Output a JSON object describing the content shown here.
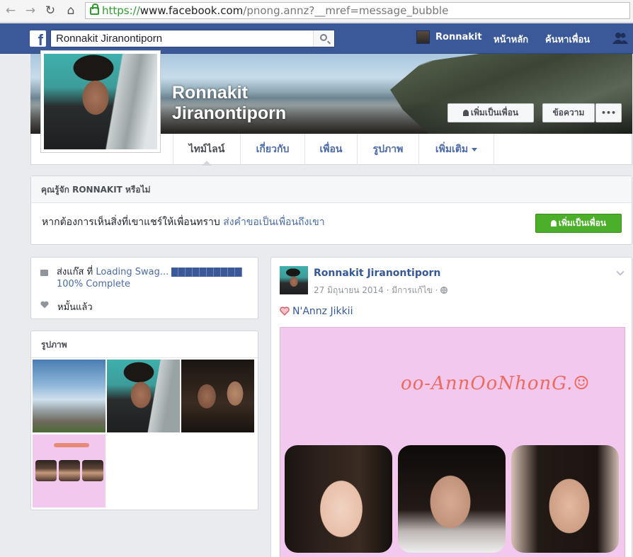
{
  "browser": {
    "url_protocol": "https://",
    "url_host": "www.facebook.com",
    "url_path": "/pnong.annz?__mref=message_bubble"
  },
  "header": {
    "search_value": "Ronnakit Jiranontiporn",
    "user_name": "Ronnakit",
    "home_label": "หน้าหลัก",
    "find_friends_label": "ค้นหาเพื่อน"
  },
  "profile": {
    "name_line1": "Ronnakit",
    "name_line2": "Jiranontiporn",
    "add_friend_label": "เพิ่มเป็นเพื่อน",
    "message_label": "ข้อความ",
    "more_label": "•••"
  },
  "tabs": [
    {
      "label": "ไทม์ไลน์"
    },
    {
      "label": "เกี่ยวกับ"
    },
    {
      "label": "เพื่อน"
    },
    {
      "label": "รูปภาพ"
    },
    {
      "label": "เพิ่มเติม"
    }
  ],
  "know": {
    "title": "คุณรู้จัก RONNAKIT หรือไม่",
    "text": "หากต้องการเห็นสิ่งที่เขาแชร์ให้เพื่อนทราบ ",
    "link": "ส่งคำขอเป็นเพื่อนถึงเขา",
    "button_label": "เพิ่มเป็นเพื่อน"
  },
  "intro": {
    "work_prefix": "ส่งแก๊ส ที่ ",
    "work_link": "Loading Swag...",
    "work_link2": "100% Complete",
    "relationship": "หมั้นแล้ว"
  },
  "photos": {
    "title": "รูปภาพ"
  },
  "post": {
    "author": "Ronnakit Jiranontiporn",
    "meta": "27 มิถุนายน 2014 · มีการแก้ไข · ",
    "feeling": "N'Annz Jikkii",
    "image_logo_text": "oo-AnnOoNhonG.☺"
  },
  "colors": {
    "facebook_blue": "#3b5998",
    "link_blue": "#365899",
    "green_button": "#4caf2a",
    "post_image_bg": "#f2c8ef"
  }
}
